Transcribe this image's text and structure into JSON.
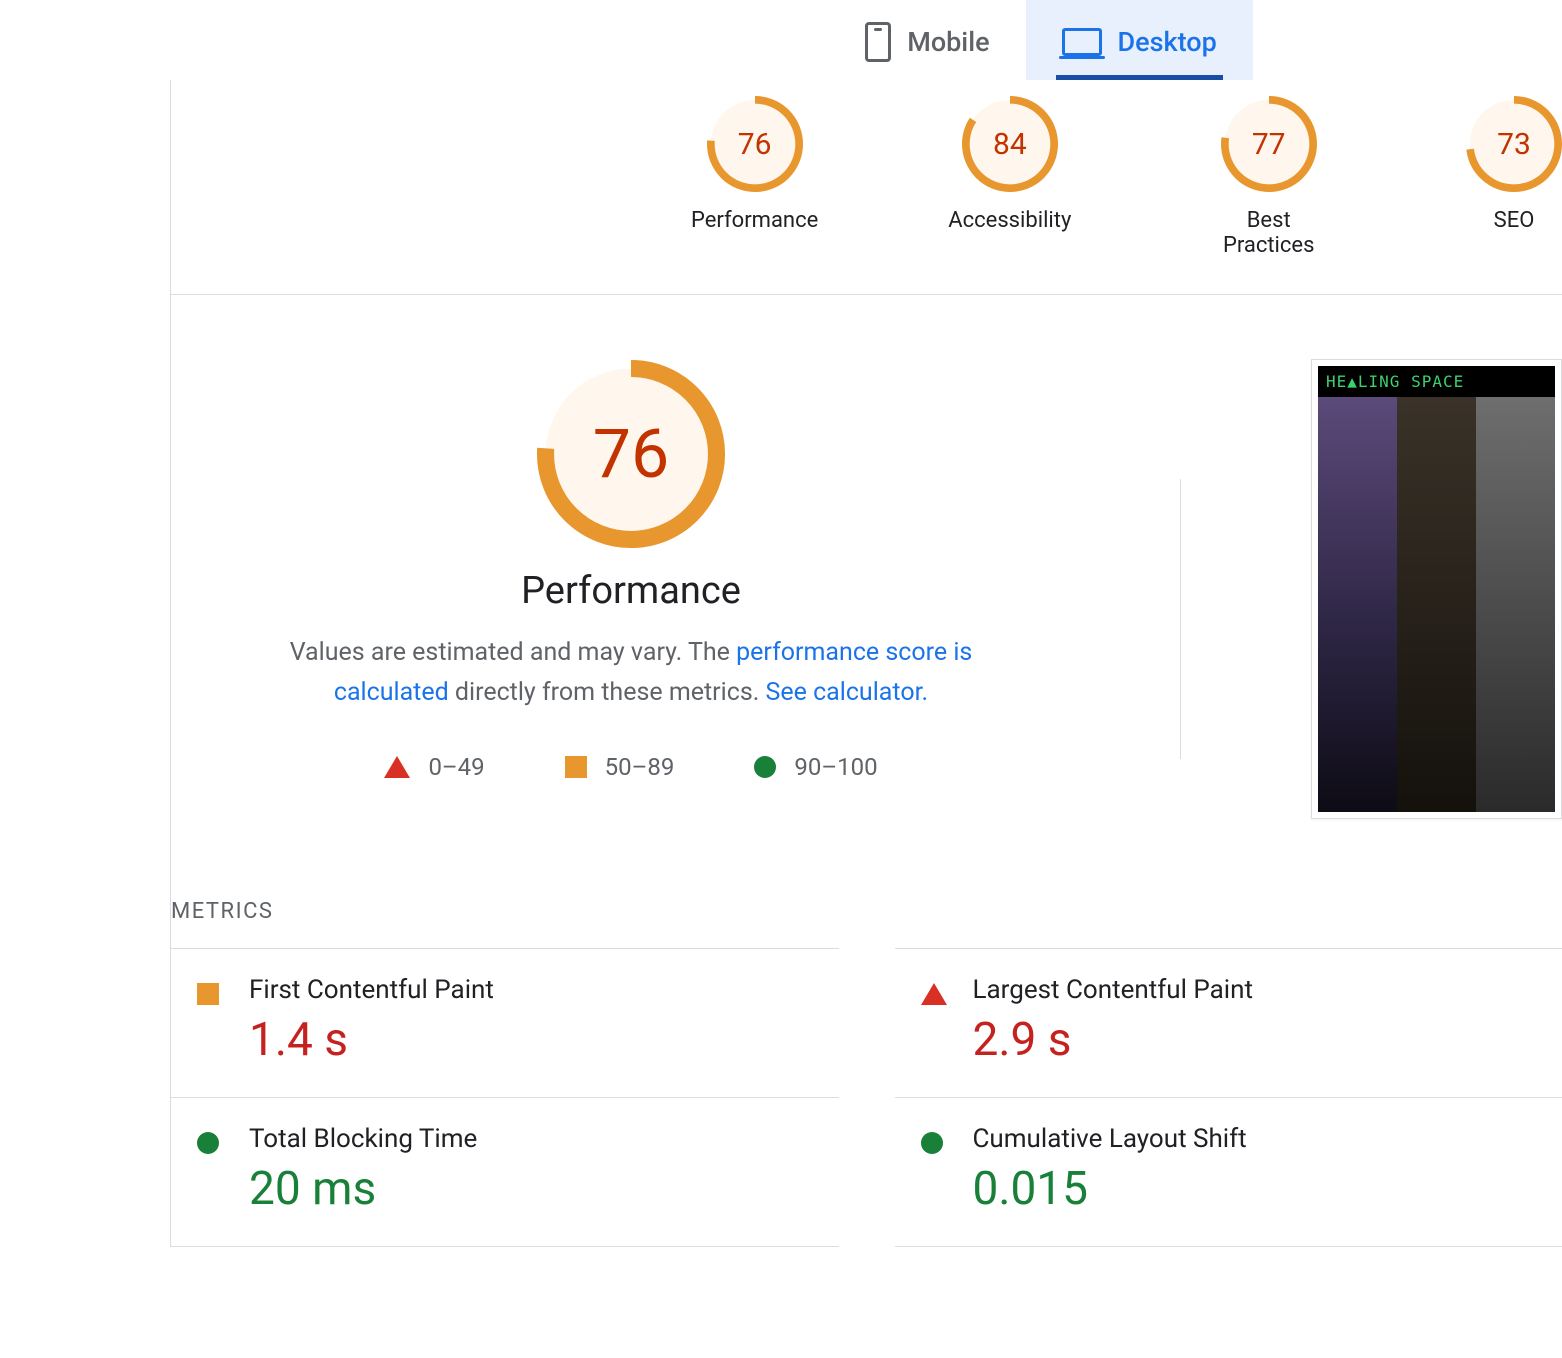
{
  "tabs": {
    "mobile": "Mobile",
    "desktop": "Desktop",
    "active": "desktop"
  },
  "gauges": [
    {
      "score": 76,
      "label": "Performance"
    },
    {
      "score": 84,
      "label": "Accessibility"
    },
    {
      "score": 77,
      "label": "Best Practices"
    },
    {
      "score": 73,
      "label": "SEO"
    }
  ],
  "hero": {
    "score": 76,
    "title": "Performance",
    "desc_prefix": "Values are estimated and may vary. The ",
    "link1": "performance score is calculated",
    "desc_middle": " directly from these metrics. ",
    "link2": "See calculator."
  },
  "legend": {
    "fail": "0–49",
    "avg": "50–89",
    "pass": "90–100"
  },
  "thumbnail": {
    "banner": "HE▲LING SPACE"
  },
  "metrics_heading": "METRICS",
  "metrics": {
    "fcp": {
      "name": "First Contentful Paint",
      "value": "1.4 s",
      "status": "avg"
    },
    "lcp": {
      "name": "Largest Contentful Paint",
      "value": "2.9 s",
      "status": "fail"
    },
    "tbt": {
      "name": "Total Blocking Time",
      "value": "20 ms",
      "status": "pass"
    },
    "cls": {
      "name": "Cumulative Layout Shift",
      "value": "0.015",
      "status": "pass"
    }
  },
  "colors": {
    "fail": "#d93025",
    "avg": "#e8962e",
    "pass": "#188038"
  }
}
